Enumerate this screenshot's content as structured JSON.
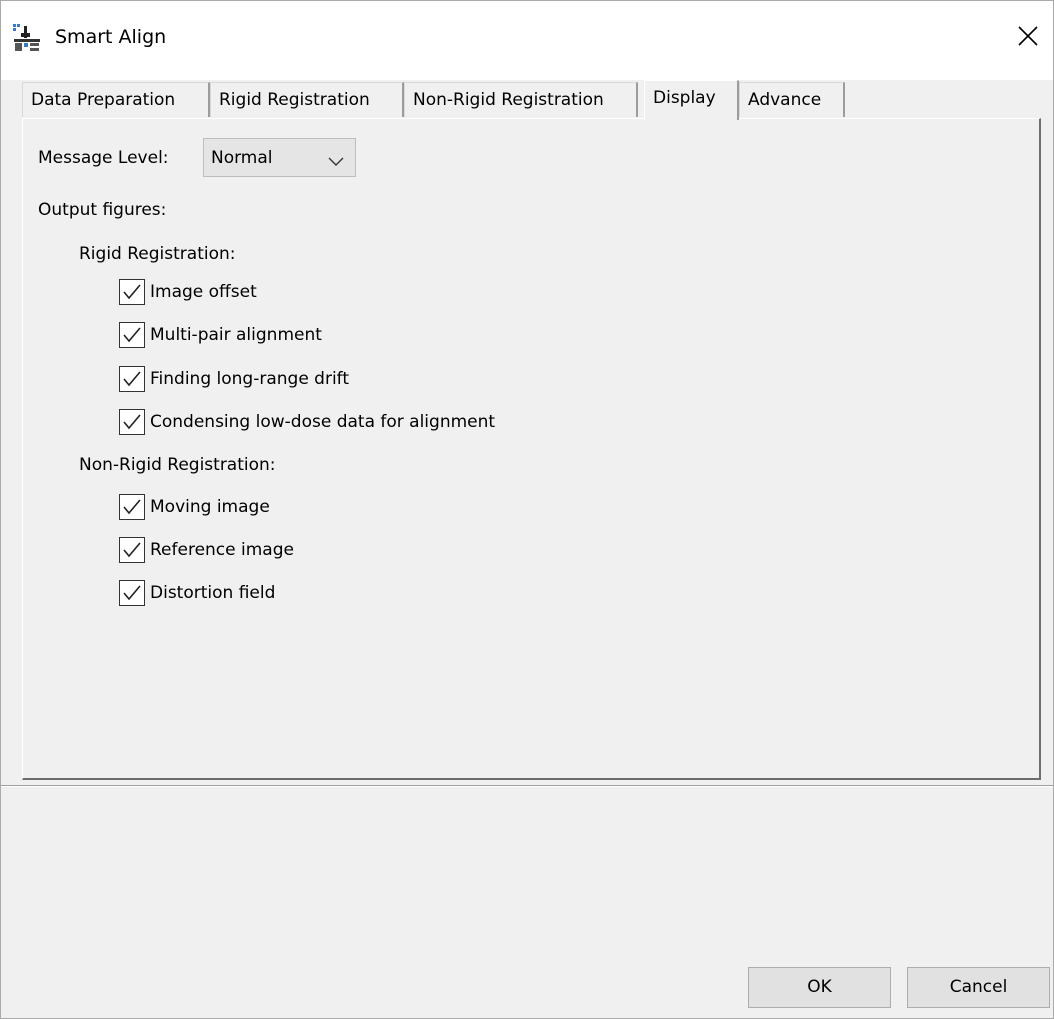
{
  "window": {
    "title": "Smart Align",
    "icon": "smart-align-app-icon",
    "close_icon": "close-icon"
  },
  "tabs": [
    {
      "label": "Data Preparation",
      "selected": false
    },
    {
      "label": "Rigid Registration",
      "selected": false
    },
    {
      "label": "Non-Rigid Registration",
      "selected": false
    },
    {
      "label": "Display",
      "selected": true
    },
    {
      "label": "Advance",
      "selected": false
    }
  ],
  "display": {
    "message_level_label": "Message Level:",
    "message_level_value": "Normal",
    "output_figures_label": "Output figures:",
    "rigid": {
      "heading": "Rigid Registration:",
      "items": [
        {
          "label": "Image offset",
          "checked": true
        },
        {
          "label": "Multi-pair alignment",
          "checked": true
        },
        {
          "label": "Finding long-range drift",
          "checked": true
        },
        {
          "label": "Condensing low-dose data for alignment",
          "checked": true
        }
      ]
    },
    "nonrigid": {
      "heading": "Non-Rigid Registration:",
      "items": [
        {
          "label": "Moving image",
          "checked": true
        },
        {
          "label": "Reference image",
          "checked": true
        },
        {
          "label": "Distortion field",
          "checked": true
        }
      ]
    }
  },
  "buttons": {
    "ok": "OK",
    "cancel": "Cancel"
  },
  "colors": {
    "background": "#f0f0f0",
    "titlebar": "#ffffff",
    "button": "#e1e1e1"
  }
}
